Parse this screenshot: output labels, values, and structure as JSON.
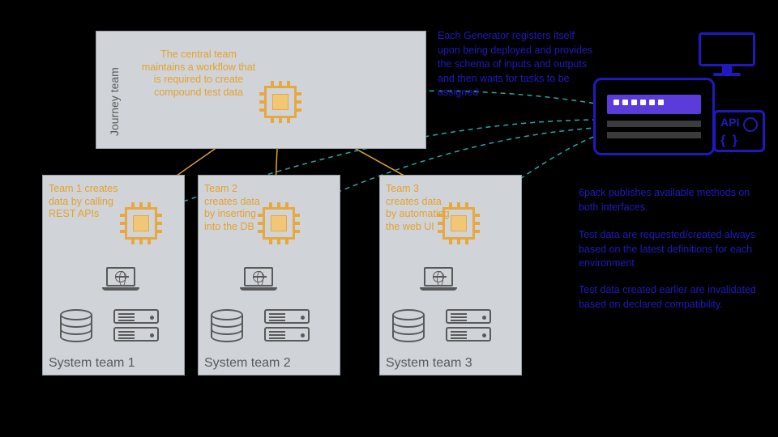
{
  "journey": {
    "label": "Journey team",
    "note": "The central team maintains a workflow that is required to create compound test data"
  },
  "generatorNote": "Each Generator registers itself upon being deployed and provides the schema of inputs and outputs and then waits for tasks to be assigned",
  "teams": [
    {
      "title": "System team 1",
      "note": "Team 1 creates data by calling REST APIs"
    },
    {
      "title": "System team 2",
      "note": "Team 2 creates data by inserting into the DB"
    },
    {
      "title": "System team 3",
      "note": "Team 3 creates data by automating the web UI"
    }
  ],
  "rightNotes": [
    "6pack publishes available methods on both interfaces.",
    "Test data are requested/created always based on the latest definitions for each environment",
    "Test data created earlier are invalidated based on declared compatibility."
  ],
  "colors": {
    "orange": "#e5a12b",
    "blue": "#2019bf",
    "boxFill": "#d0d4d9",
    "icon": "#595959",
    "teal": "#2aa8a8"
  }
}
